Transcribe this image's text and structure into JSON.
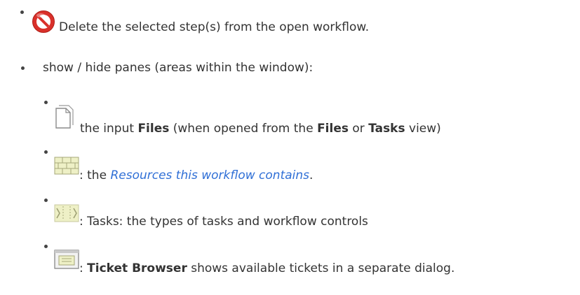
{
  "items": {
    "delete": {
      "icon": "no-entry-icon",
      "text": "Delete the selected step(s) from the open workflow."
    },
    "panes": {
      "text": "show / hide panes (areas within the window):"
    },
    "files": {
      "icon": "document-icon",
      "prefix": "the input ",
      "bold1": "Files",
      "middle": " (when opened from the ",
      "bold2": "Files",
      "or": " or ",
      "bold3": "Tasks",
      "suffix": " view)"
    },
    "resources": {
      "icon": "resources-icon",
      "prefix": ": the ",
      "link": "Resources this workflow contains",
      "suffix": "."
    },
    "tasks": {
      "icon": "tasks-icon",
      "text": ": Tasks: the types of tasks and workflow controls"
    },
    "ticket_browser": {
      "icon": "ticket-browser-icon",
      "prefix": ": ",
      "bold": "Ticket Browser",
      "suffix": " shows available tickets in a separate dialog."
    }
  },
  "colors": {
    "link": "#2f6fd6",
    "text": "#333333",
    "delete_icon": "#d9302a"
  }
}
